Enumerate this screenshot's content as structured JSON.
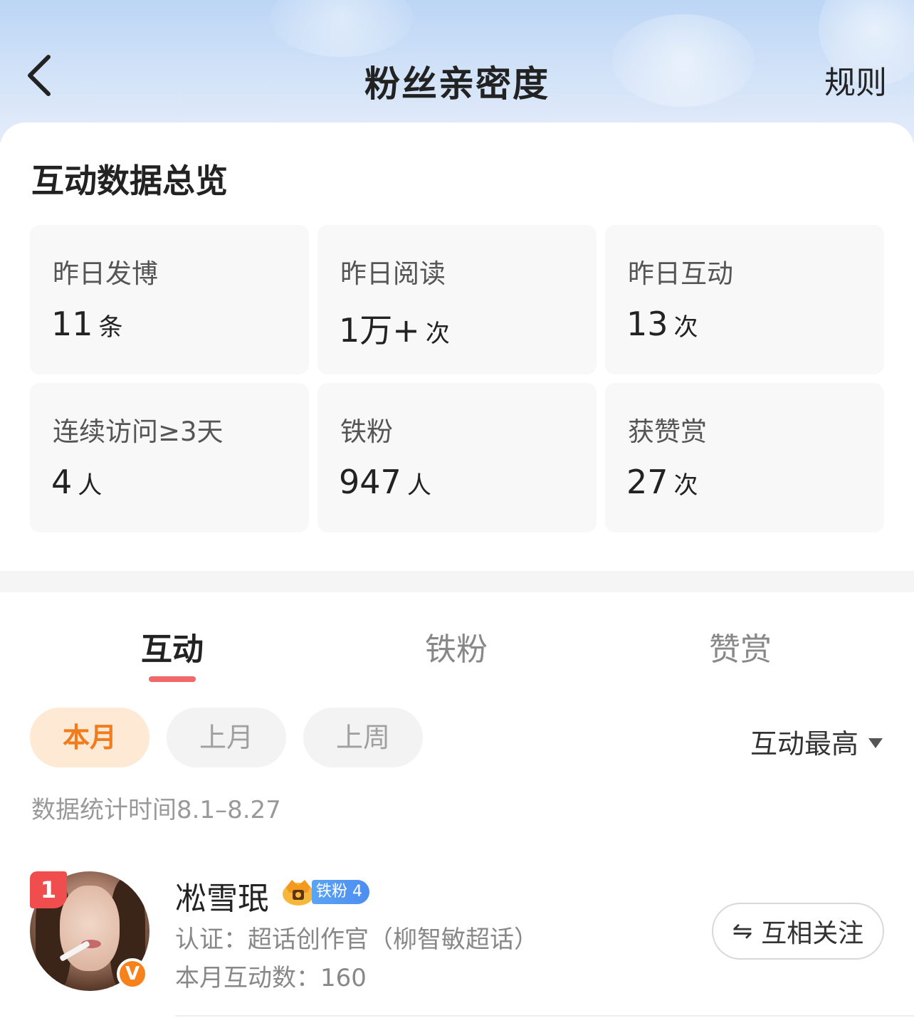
{
  "header": {
    "title": "粉丝亲密度",
    "rules_label": "规则",
    "back_icon": "chevron-left-icon"
  },
  "overview": {
    "title": "互动数据总览",
    "stats": [
      {
        "label": "昨日发博",
        "value": "11",
        "unit": "条"
      },
      {
        "label": "昨日阅读",
        "value": "1万+",
        "unit": "次"
      },
      {
        "label": "昨日互动",
        "value": "13",
        "unit": "次"
      },
      {
        "label": "连续访问≥3天",
        "value": "4",
        "unit": "人"
      },
      {
        "label": "铁粉",
        "value": "947",
        "unit": "人"
      },
      {
        "label": "获赞赏",
        "value": "27",
        "unit": "次"
      }
    ]
  },
  "tabs": [
    {
      "label": "互动",
      "active": true
    },
    {
      "label": "铁粉",
      "active": false
    },
    {
      "label": "赞赏",
      "active": false
    }
  ],
  "filters": {
    "chips": [
      {
        "label": "本月",
        "active": true
      },
      {
        "label": "上月",
        "active": false
      },
      {
        "label": "上周",
        "active": false
      }
    ],
    "sort_label": "互动最高",
    "period_text": "数据统计时间8.1–8.27"
  },
  "list": [
    {
      "rank": "1",
      "name": "凇雪珉",
      "fan_badge": "铁粉 4",
      "verify_mark": "V",
      "cert": "认证：超话创作官（柳智敏超话）",
      "count_text": "本月互动数：160",
      "follow_label": "互相关注",
      "follow_icon": "⇋"
    }
  ],
  "colors": {
    "accent_tab": "#f0686a",
    "chip_active_bg": "#fde9d4",
    "chip_active_text": "#f07c1e",
    "rank_badge": "#f04e4e",
    "verify_badge": "#f7821b",
    "fan_badge": "#4d8df0"
  }
}
